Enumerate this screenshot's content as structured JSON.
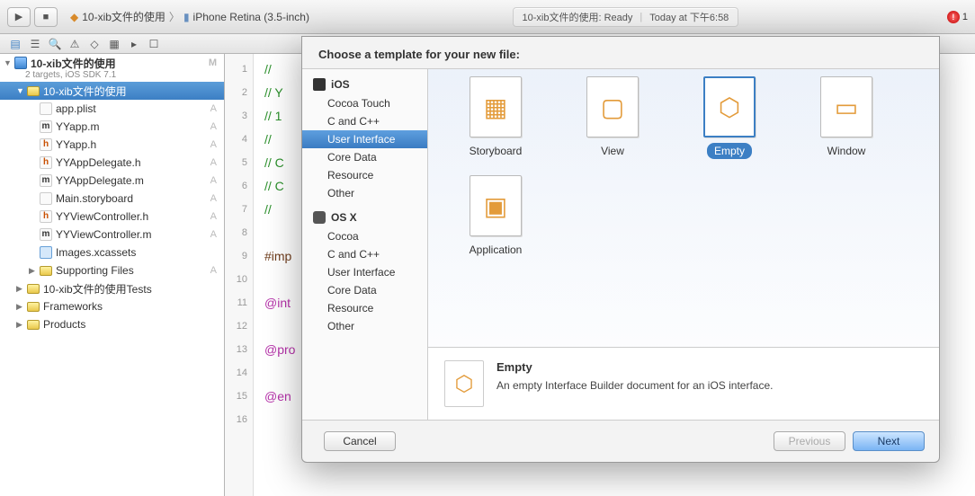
{
  "breadcrumb": {
    "project": "10-xib文件的使用",
    "device": "iPhone Retina (3.5-inch)"
  },
  "status": {
    "left": "10-xib文件的使用: Ready",
    "right": "Today at 下午6:58",
    "errorCount": "1"
  },
  "navigator": {
    "project": "10-xib文件的使用",
    "subtitle": "2 targets, iOS SDK 7.1",
    "projectLetter": "M",
    "rootFolder": "10-xib文件的使用",
    "files": [
      {
        "name": "app.plist",
        "kind": "plist",
        "letter": "A"
      },
      {
        "name": "YYapp.m",
        "kind": "m",
        "letter": "A"
      },
      {
        "name": "YYapp.h",
        "kind": "h",
        "letter": "A"
      },
      {
        "name": "YYAppDelegate.h",
        "kind": "h",
        "letter": "A"
      },
      {
        "name": "YYAppDelegate.m",
        "kind": "m",
        "letter": "A"
      },
      {
        "name": "Main.storyboard",
        "kind": "sb",
        "letter": "A"
      },
      {
        "name": "YYViewController.h",
        "kind": "h",
        "letter": "A"
      },
      {
        "name": "YYViewController.m",
        "kind": "m",
        "letter": "A"
      },
      {
        "name": "Images.xcassets",
        "kind": "assets",
        "letter": ""
      }
    ],
    "folders": [
      {
        "name": "Supporting Files",
        "letter": "A"
      },
      {
        "name": "10-xib文件的使用Tests",
        "letter": ""
      },
      {
        "name": "Frameworks",
        "letter": ""
      },
      {
        "name": "Products",
        "letter": ""
      }
    ]
  },
  "code": {
    "lines": [
      "//",
      "//  Y",
      "//  1",
      "//",
      "//  C",
      "//  C",
      "//",
      "",
      "#imp",
      "",
      "@int",
      "",
      "@pro",
      "",
      "@en",
      ""
    ],
    "classes": [
      "comment",
      "comment",
      "comment",
      "comment",
      "comment",
      "comment",
      "comment",
      "",
      "directive",
      "",
      "key",
      "",
      "key",
      "",
      "key",
      ""
    ]
  },
  "sheet": {
    "header": "Choose a template for your new file:",
    "ios": {
      "label": "iOS",
      "items": [
        "Cocoa Touch",
        "C and C++",
        "User Interface",
        "Core Data",
        "Resource",
        "Other"
      ],
      "selected": "User Interface"
    },
    "osx": {
      "label": "OS X",
      "items": [
        "Cocoa",
        "C and C++",
        "User Interface",
        "Core Data",
        "Resource",
        "Other"
      ]
    },
    "templates": [
      "Storyboard",
      "View",
      "Empty",
      "Window",
      "Application"
    ],
    "selected": "Empty",
    "desc": {
      "title": "Empty",
      "body": "An empty Interface Builder document for an iOS interface."
    },
    "buttons": {
      "cancel": "Cancel",
      "previous": "Previous",
      "next": "Next"
    }
  }
}
